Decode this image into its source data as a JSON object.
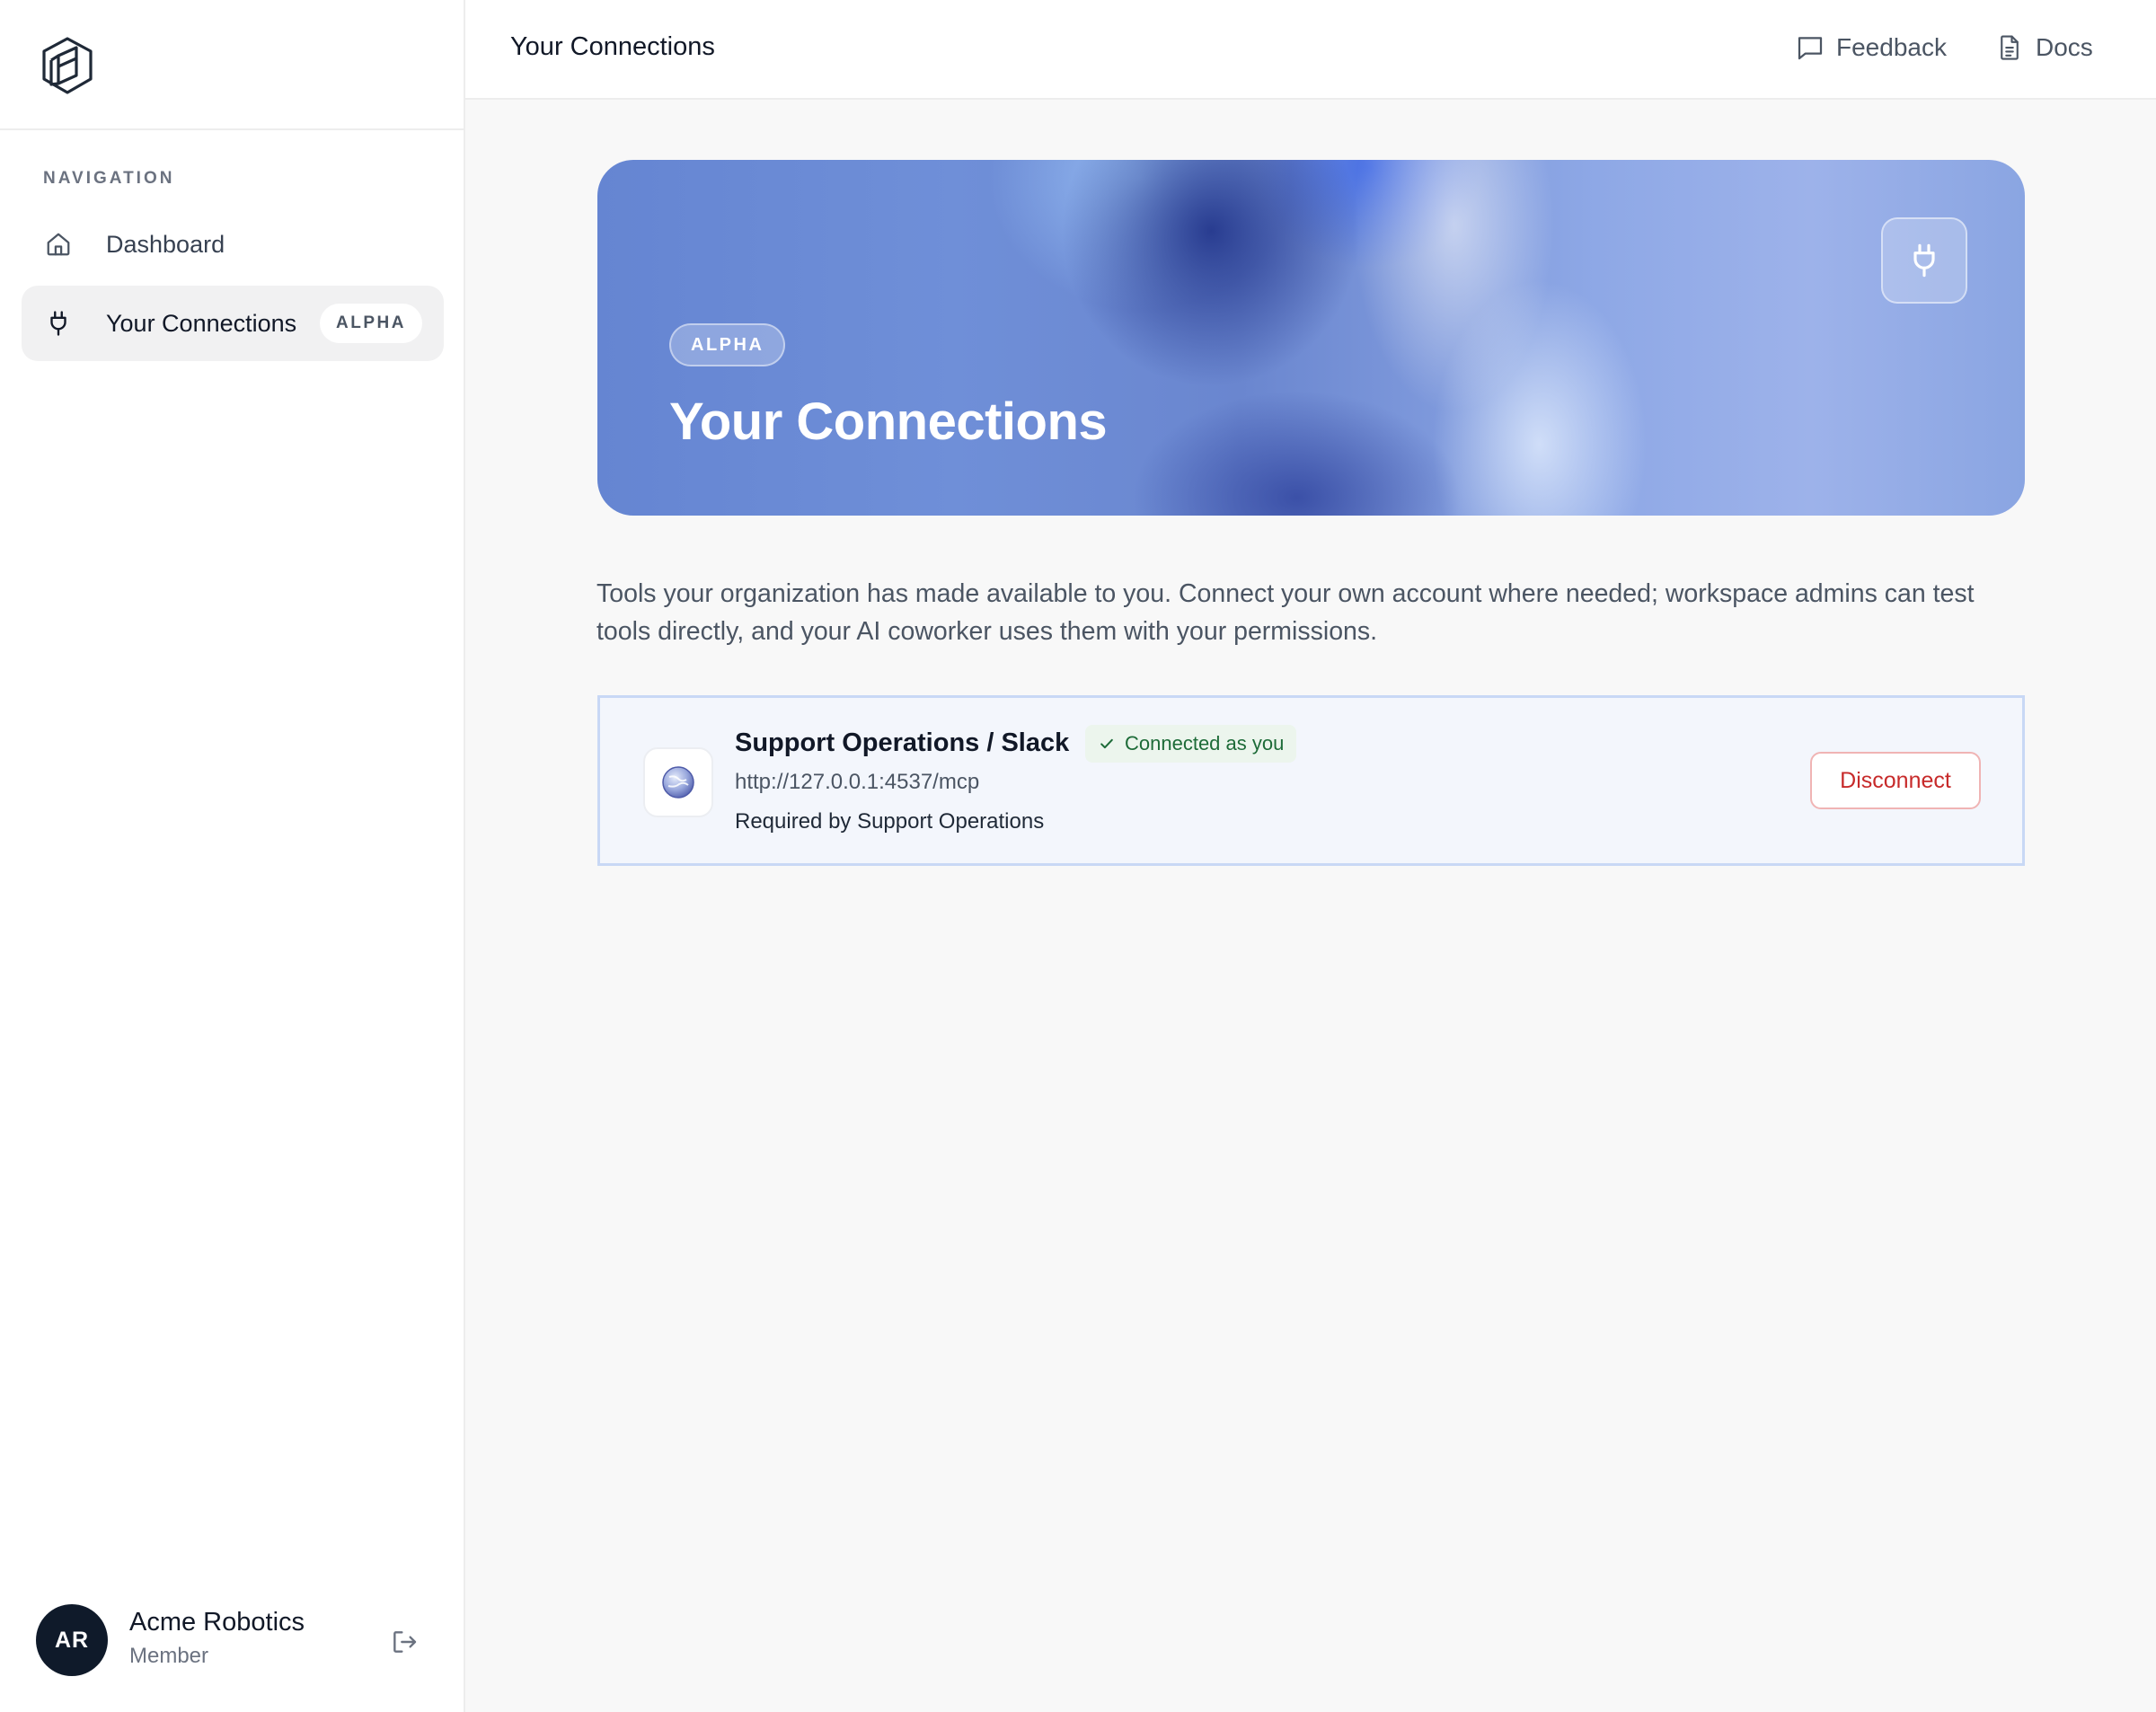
{
  "sidebar": {
    "logo_icon": "hexagon-logo-icon",
    "nav_heading": "NAVIGATION",
    "items": [
      {
        "label": "Dashboard",
        "icon": "home-icon"
      },
      {
        "label": "Your Connections",
        "icon": "plug-icon",
        "badge": "ALPHA",
        "active": true
      }
    ],
    "user": {
      "initials": "AR",
      "name": "Acme Robotics",
      "role": "Member",
      "logout_icon": "logout-icon"
    }
  },
  "topbar": {
    "title": "Your Connections",
    "links": [
      {
        "label": "Feedback",
        "icon": "message-square-icon"
      },
      {
        "label": "Docs",
        "icon": "document-icon"
      }
    ]
  },
  "hero": {
    "badge": "ALPHA",
    "title": "Your Connections",
    "icon": "plug-icon"
  },
  "intro": "Tools your organization has made available to you. Connect your own account where needed; workspace admins can test tools directly, and your AI coworker uses them with your permissions.",
  "connections": [
    {
      "name": "Support Operations / Slack",
      "status": "Connected as you",
      "url": "http://127.0.0.1:4537/mcp",
      "requirement": "Required by Support Operations",
      "icon": "globe-icon",
      "action": "Disconnect"
    }
  ],
  "colors": {
    "accent": "#6a86cf",
    "status_green": "#1d6b38",
    "danger": "#c72a2a",
    "avatar_bg": "#0f1a2a"
  }
}
